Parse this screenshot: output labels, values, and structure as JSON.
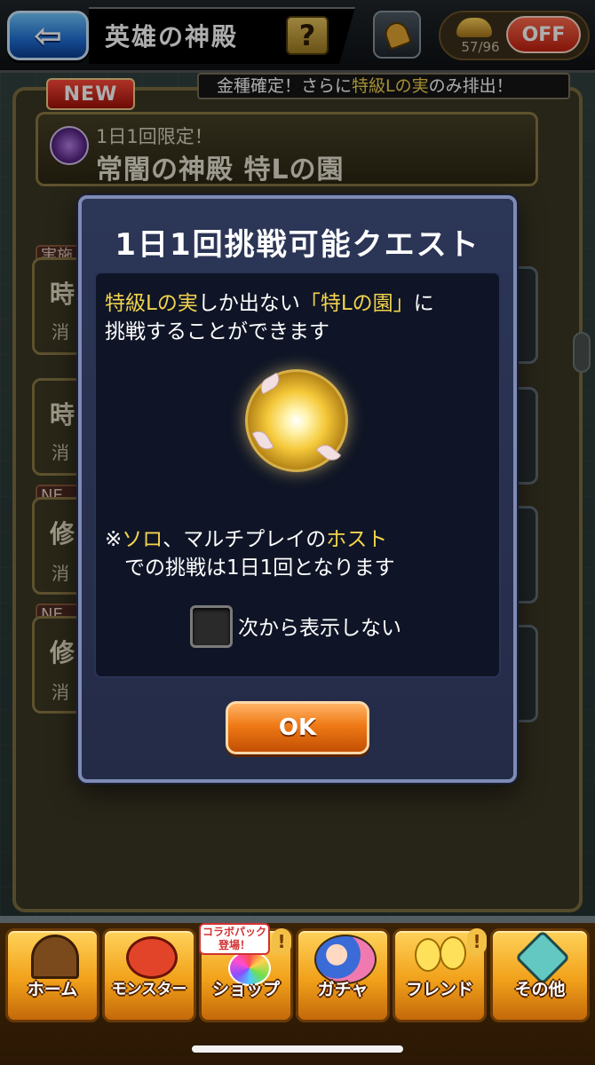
{
  "header": {
    "title": "英雄の神殿",
    "help_label": "?",
    "stamina": "57/96",
    "toggle_label": "OFF"
  },
  "ribbon": {
    "prefix": "金種確定！さらに",
    "highlight": "特級Lの実",
    "suffix": "のみ排出！"
  },
  "quest": {
    "badge": "NEW",
    "subtitle": "1日1回限定！",
    "title": "常闇の神殿 特Lの園"
  },
  "list_fragments": {
    "card1_tag": "実施",
    "card1_glyph": "時",
    "card1_small": "消",
    "card2_glyph": "時",
    "card2_small": "消",
    "card3_tag": "NE",
    "card3_glyph": "修",
    "card3_small": "消",
    "card4_tag": "NE",
    "card4_glyph": "修",
    "card4_small": "消"
  },
  "modal": {
    "title": "1日1回挑戦可能クエスト",
    "line1_a": "特級Lの実",
    "line1_b": "しか出ない",
    "line1_c": "「特Lの園」",
    "line1_d": "に",
    "line2": "挑戦することができます",
    "note1_a": "※",
    "note1_b": "ソロ",
    "note1_c": "、マルチプレイの",
    "note1_d": "ホスト",
    "note2": "での挑戦は1日1回となります",
    "checkbox_label": "次から表示しない",
    "checkbox_checked": false,
    "ok_label": "OK"
  },
  "tabs": [
    {
      "label": "ホーム",
      "icon": "temple-door-icon"
    },
    {
      "label": "モンスター",
      "icon": "dragon-icon"
    },
    {
      "label": "ショップ",
      "icon": "rainbow-orb-icon",
      "badge": "コラボパック登場！"
    },
    {
      "label": "ガチャ",
      "icon": "characters-icon"
    },
    {
      "label": "フレンド",
      "icon": "balloons-icon"
    },
    {
      "label": "その他",
      "icon": "question-diamond-icon"
    }
  ],
  "colors": {
    "accent_yellow": "#f2d34e",
    "ok_orange": "#f07a16",
    "modal_bg": "#2c3657"
  }
}
